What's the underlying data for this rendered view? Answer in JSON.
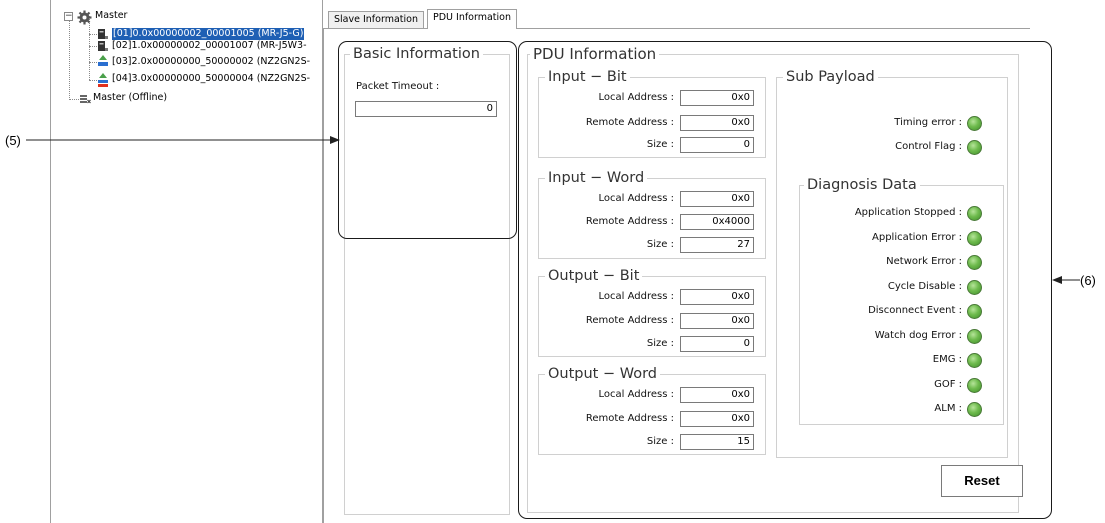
{
  "tree": {
    "items": [
      {
        "label": "Master"
      },
      {
        "label": "[01]0.0x00000002_00001005 (MR-J5-G)",
        "selected": true
      },
      {
        "label": "[02]1.0x00000002_00001007 (MR-J5W3-"
      },
      {
        "label": "[03]2.0x00000000_50000002 (NZ2GN2S-"
      },
      {
        "label": "[04]3.0x00000000_50000004 (NZ2GN2S-"
      },
      {
        "label": "Master (Offline)"
      }
    ],
    "expander_symbol": "−"
  },
  "tabs": [
    {
      "label": "Slave Information",
      "active": false
    },
    {
      "label": "PDU Information",
      "active": true
    }
  ],
  "basic_information": {
    "title": "Basic Information",
    "packet_timeout_label": "Packet Timeout :",
    "packet_timeout_value": "0"
  },
  "pdu_information": {
    "title": "PDU Information",
    "input_bit": {
      "title": "Input − Bit",
      "local_address_label": "Local Address :",
      "local_address": "0x0",
      "remote_address_label": "Remote Address :",
      "remote_address": "0x0",
      "size_label": "Size :",
      "size": "0"
    },
    "input_word": {
      "title": "Input − Word",
      "local_address_label": "Local Address :",
      "local_address": "0x0",
      "remote_address_label": "Remote Address :",
      "remote_address": "0x4000",
      "size_label": "Size :",
      "size": "27"
    },
    "output_bit": {
      "title": "Output − Bit",
      "local_address_label": "Local Address :",
      "local_address": "0x0",
      "remote_address_label": "Remote Address :",
      "remote_address": "0x0",
      "size_label": "Size :",
      "size": "0"
    },
    "output_word": {
      "title": "Output − Word",
      "local_address_label": "Local Address :",
      "local_address": "0x0",
      "remote_address_label": "Remote Address :",
      "remote_address": "0x0",
      "size_label": "Size :",
      "size": "15"
    },
    "sub_payload": {
      "title": "Sub Payload",
      "timing_error_label": "Timing error :",
      "control_flag_label": "Control Flag :"
    },
    "diagnosis_data": {
      "title": "Diagnosis Data",
      "items": [
        "Application Stopped :",
        "Application Error :",
        "Network Error :",
        "Cycle Disable :",
        "Disconnect Event :",
        "Watch dog Error :",
        "EMG :",
        "GOF :",
        "ALM :"
      ]
    },
    "reset_label": "Reset"
  },
  "annotations": {
    "left_label": "(5)",
    "right_label": "(6)"
  },
  "colors": {
    "selection": "#1e5fb4",
    "led_on": "#6fbb4e",
    "group_border": "#d0d0d0"
  },
  "icons": [
    "expander-icon",
    "master-gear-icon",
    "servo-amplifier-icon",
    "network-module-icon",
    "offline-master-icon"
  ]
}
